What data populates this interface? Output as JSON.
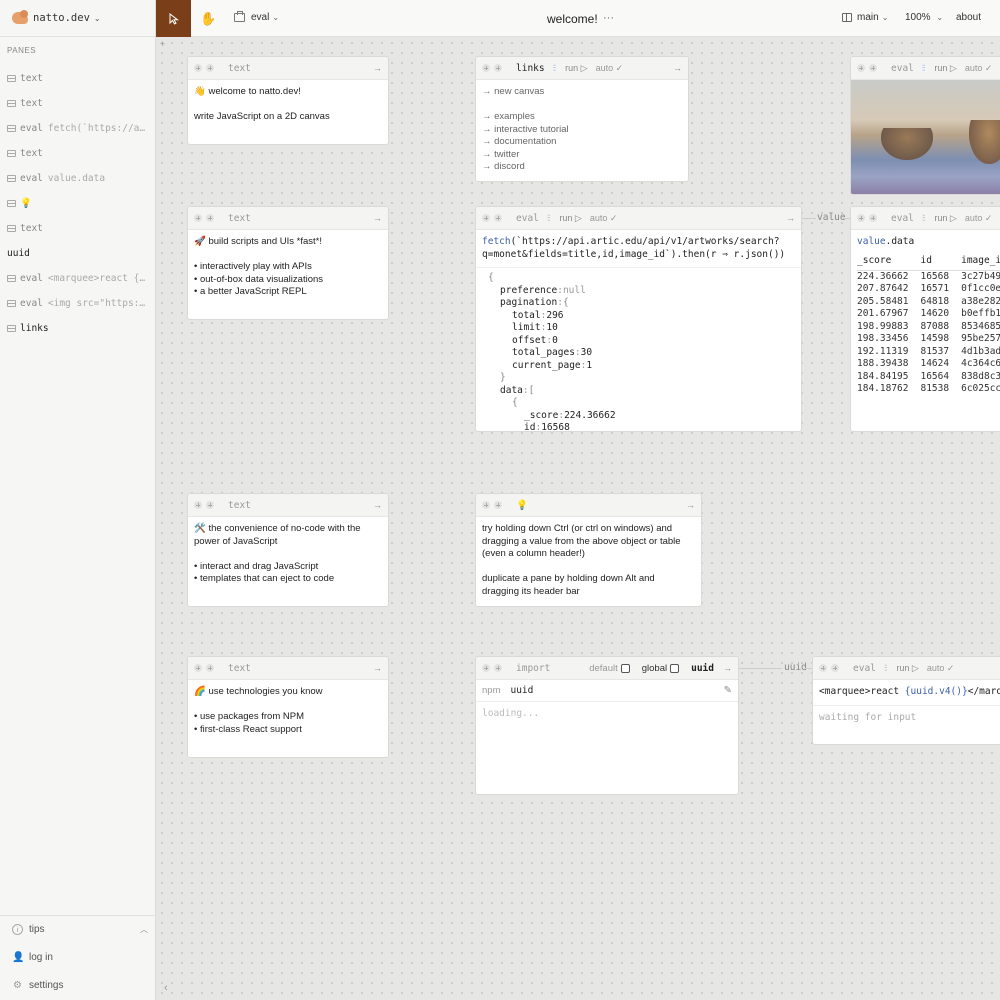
{
  "brand": {
    "name": "natto.dev"
  },
  "sidebar": {
    "panes_header": "PANES",
    "items": [
      {
        "kind": "text",
        "detail": ""
      },
      {
        "kind": "text",
        "detail": ""
      },
      {
        "kind": "eval",
        "detail": "fetch(`https://a…"
      },
      {
        "kind": "text",
        "detail": ""
      },
      {
        "kind": "eval",
        "detail": "value.data"
      },
      {
        "kind": "💡",
        "detail": ""
      },
      {
        "kind": "text",
        "detail": ""
      },
      {
        "kind": "uuid",
        "detail": ""
      },
      {
        "kind": "eval",
        "detail": "<marquee>react {…"
      },
      {
        "kind": "eval",
        "detail": "<img src=\"https:…"
      },
      {
        "kind": "links",
        "detail": ""
      }
    ],
    "tips": "tips",
    "login": "log in",
    "settings": "settings"
  },
  "toolbar": {
    "new_pane_label": "eval",
    "title": "welcome!",
    "menu": "···",
    "branch": "main",
    "zoom": "100%",
    "about": "about"
  },
  "panes": {
    "text1": {
      "title": "text",
      "line1": "👋  welcome to natto.dev!",
      "line2": "write JavaScript on a 2D canvas"
    },
    "links": {
      "title": "links",
      "run": "run ▷",
      "auto": "auto ✓",
      "items": [
        "→ new canvas",
        "",
        "→ examples",
        "→ interactive tutorial",
        "→ documentation",
        "→ twitter",
        "→ discord"
      ]
    },
    "img_eval": {
      "title": "eval",
      "run": "run ▷",
      "auto": "auto ✓"
    },
    "text2": {
      "title": "text",
      "heading": "🚀  build scripts and UIs *fast*!",
      "bullets": [
        "• interactively play with APIs",
        "• out-of-box data visualizations",
        "• a better JavaScript REPL"
      ]
    },
    "fetch_eval": {
      "title": "eval",
      "run": "run ▷",
      "auto": "auto ✓",
      "code_fn": "fetch",
      "code_line1": "(`https://api.artic.edu/api/v1/artworks/search?",
      "code_line2": "q=monet&fields=title,id,image_id`).then(r ⇒ r.json())",
      "json": {
        "open": "{",
        "preference_key": "preference",
        "preference_val": "null",
        "pagination_key": "pagination",
        "pagination_open": "{",
        "total_key": "total",
        "total_val": "296",
        "limit_key": "limit",
        "limit_val": "10",
        "offset_key": "offset",
        "offset_val": "0",
        "total_pages_key": "total_pages",
        "total_pages_val": "30",
        "current_page_key": "current_page",
        "current_page_val": "1",
        "pagination_close": "}",
        "data_key": "data",
        "data_open": "[",
        "item_open": "{",
        "score_key": "_score",
        "score_val": "224.36662",
        "id_key": "id",
        "id_val": "16568"
      }
    },
    "value_label": "value",
    "data_eval": {
      "title": "eval",
      "run": "run ▷",
      "auto": "auto ✓",
      "code_ident": "value",
      "code_prop": ".data",
      "columns": [
        "_score",
        "id",
        "image_i"
      ],
      "rows": [
        [
          "224.36662",
          "16568",
          "3c27b49"
        ],
        [
          "207.87642",
          "16571",
          "0f1cc0e"
        ],
        [
          "205.58481",
          "64818",
          "a38e282"
        ],
        [
          "201.67967",
          "14620",
          "b0effb1"
        ],
        [
          "198.99883",
          "87088",
          "8534685"
        ],
        [
          "198.33456",
          "14598",
          "95be257"
        ],
        [
          "192.11319",
          "81537",
          "4d1b3ad"
        ],
        [
          "188.39438",
          "14624",
          "4c364c6"
        ],
        [
          "184.84195",
          "16564",
          "838d8c3"
        ],
        [
          "184.18762",
          "81538",
          "6c025cc"
        ]
      ]
    },
    "text3": {
      "title": "text",
      "heading_l1": "🛠️  the convenience of no-code with the",
      "heading_l2": "power of JavaScript",
      "bullets": [
        "• interact and drag JavaScript",
        "• templates that can eject to code"
      ]
    },
    "tip": {
      "title": "💡",
      "p1": [
        "try holding down Ctrl (or ctrl on windows) and",
        "dragging a value from the above object or table",
        "(even a column header!)"
      ],
      "p2": [
        "duplicate a pane by holding down Alt and",
        "dragging its header bar"
      ]
    },
    "text4": {
      "title": "text",
      "heading": "🌈  use technologies you know",
      "bullets": [
        "• use packages from NPM",
        "• first-class React support"
      ]
    },
    "import": {
      "title": "import",
      "default_label": "default",
      "global_label": "global",
      "name": "uuid",
      "npm_label": "npm",
      "package": "uuid",
      "loading": "loading..."
    },
    "uuid_label": "uuid",
    "marquee_eval": {
      "title": "eval",
      "run": "run ▷",
      "auto": "auto ✓",
      "code_open": "<marquee>react ",
      "code_expr": "{uuid.v4()}",
      "code_close": "</marq",
      "waiting": "waiting for input"
    }
  },
  "colors": {
    "accent": "#7a3e19",
    "link_blue": "#3b5fa8",
    "canvas": "#e6e6e4"
  }
}
